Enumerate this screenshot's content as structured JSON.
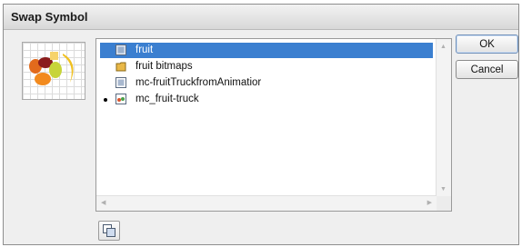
{
  "window": {
    "title": "Swap Symbol"
  },
  "preview": {
    "icon": "fruit-truck-preview"
  },
  "symbols": [
    {
      "label": "fruit",
      "icon": "bitmap-icon",
      "selected": true,
      "current": false
    },
    {
      "label": "fruit bitmaps",
      "icon": "folder-icon",
      "selected": false,
      "current": false
    },
    {
      "label": "mc-fruitTruckfromAnimatior",
      "icon": "bitmap-icon",
      "selected": false,
      "current": false
    },
    {
      "label": "mc_fruit-truck",
      "icon": "movieclip-icon",
      "selected": false,
      "current": true
    }
  ],
  "buttons": {
    "ok_label": "OK",
    "cancel_label": "Cancel"
  },
  "duplicate_button": {
    "icon": "duplicate-symbol-icon"
  },
  "colors": {
    "selection": "#3b7fd0"
  }
}
